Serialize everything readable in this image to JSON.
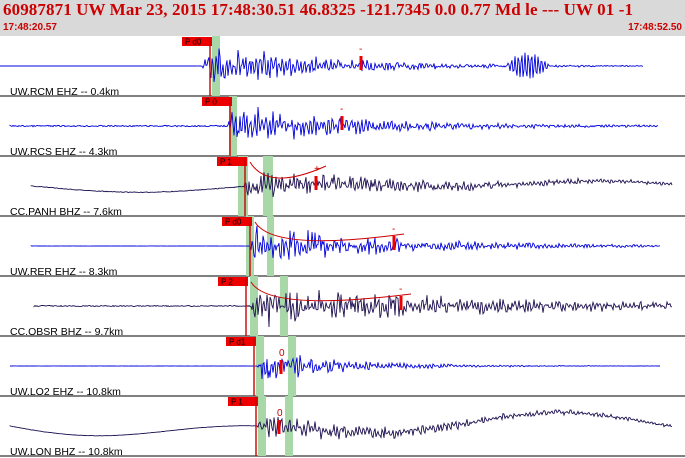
{
  "header": {
    "title": "60987871 UW Mar 23, 2015 17:48:30.51    46.8325 -121.7345  0.0 0.77 Md le --- UW 01   -1",
    "time_start": "17:48:20.57",
    "time_end": "17:48:52.50"
  },
  "colors": {
    "header_bg": "#d9d9d9",
    "title_red": "#cc0000",
    "pick_red": "#ee0000",
    "window_green": "#a8d8a8",
    "trace_blue": "#0000dd",
    "trace_navy": "#1e1050",
    "coda_line": "#cc0000"
  },
  "traces": [
    {
      "label": "UW.RCM EHZ -- 0.4km",
      "pick": "P d0",
      "polarity": "-",
      "color": "blue",
      "signal": {
        "flat_end": 0.285,
        "onset": 0.31,
        "amp": 0.95,
        "noise": 0.04,
        "decay": 0.18,
        "extra_burst": 0.77
      }
    },
    {
      "label": "UW.RCS EHZ -- 4.3km",
      "pick": "P 0",
      "polarity": "-",
      "color": "blue",
      "signal": {
        "flat_end": 0.015,
        "onset": 0.345,
        "amp": 0.9,
        "noise": 0.22,
        "decay": 0.2
      }
    },
    {
      "label": "CC.PANH BHZ -- 7.6km",
      "pick": "P 1",
      "polarity": "+",
      "color": "navy",
      "signal": {
        "flat_end": 0.045,
        "onset": 0.37,
        "amp": 0.55,
        "noise": 0.12,
        "decay": 0.3,
        "drift": 0.35
      }
    },
    {
      "label": "UW.RER EHZ -- 8.3km",
      "pick": "P d0",
      "polarity": "-",
      "color": "blue",
      "signal": {
        "flat_end": 0.045,
        "onset": 0.38,
        "amp": 0.95,
        "noise": 0.03,
        "decay": 0.2
      }
    },
    {
      "label": "CC.OBSR BHZ -- 9.7km",
      "pick": "P 2",
      "polarity": "-",
      "color": "navy",
      "signal": {
        "flat_end": 0.05,
        "onset": 0.38,
        "amp": 0.9,
        "noise": 0.18,
        "decay": 0.35
      }
    },
    {
      "label": "UW.LO2 EHZ -- 10.8km",
      "pick": "P d1",
      "polarity": "0",
      "color": "blue",
      "signal": {
        "flat_end": 0.015,
        "onset": 0.39,
        "amp": 0.8,
        "noise": 0.04,
        "decay": 0.12
      }
    },
    {
      "label": "UW.LON BHZ -- 10.8km",
      "pick": "P 1",
      "polarity": "0",
      "color": "navy",
      "signal": {
        "flat_end": 0.015,
        "onset": 0.39,
        "amp": 0.5,
        "noise": 0.05,
        "decay": 0.3,
        "drift": 0.75
      }
    }
  ]
}
